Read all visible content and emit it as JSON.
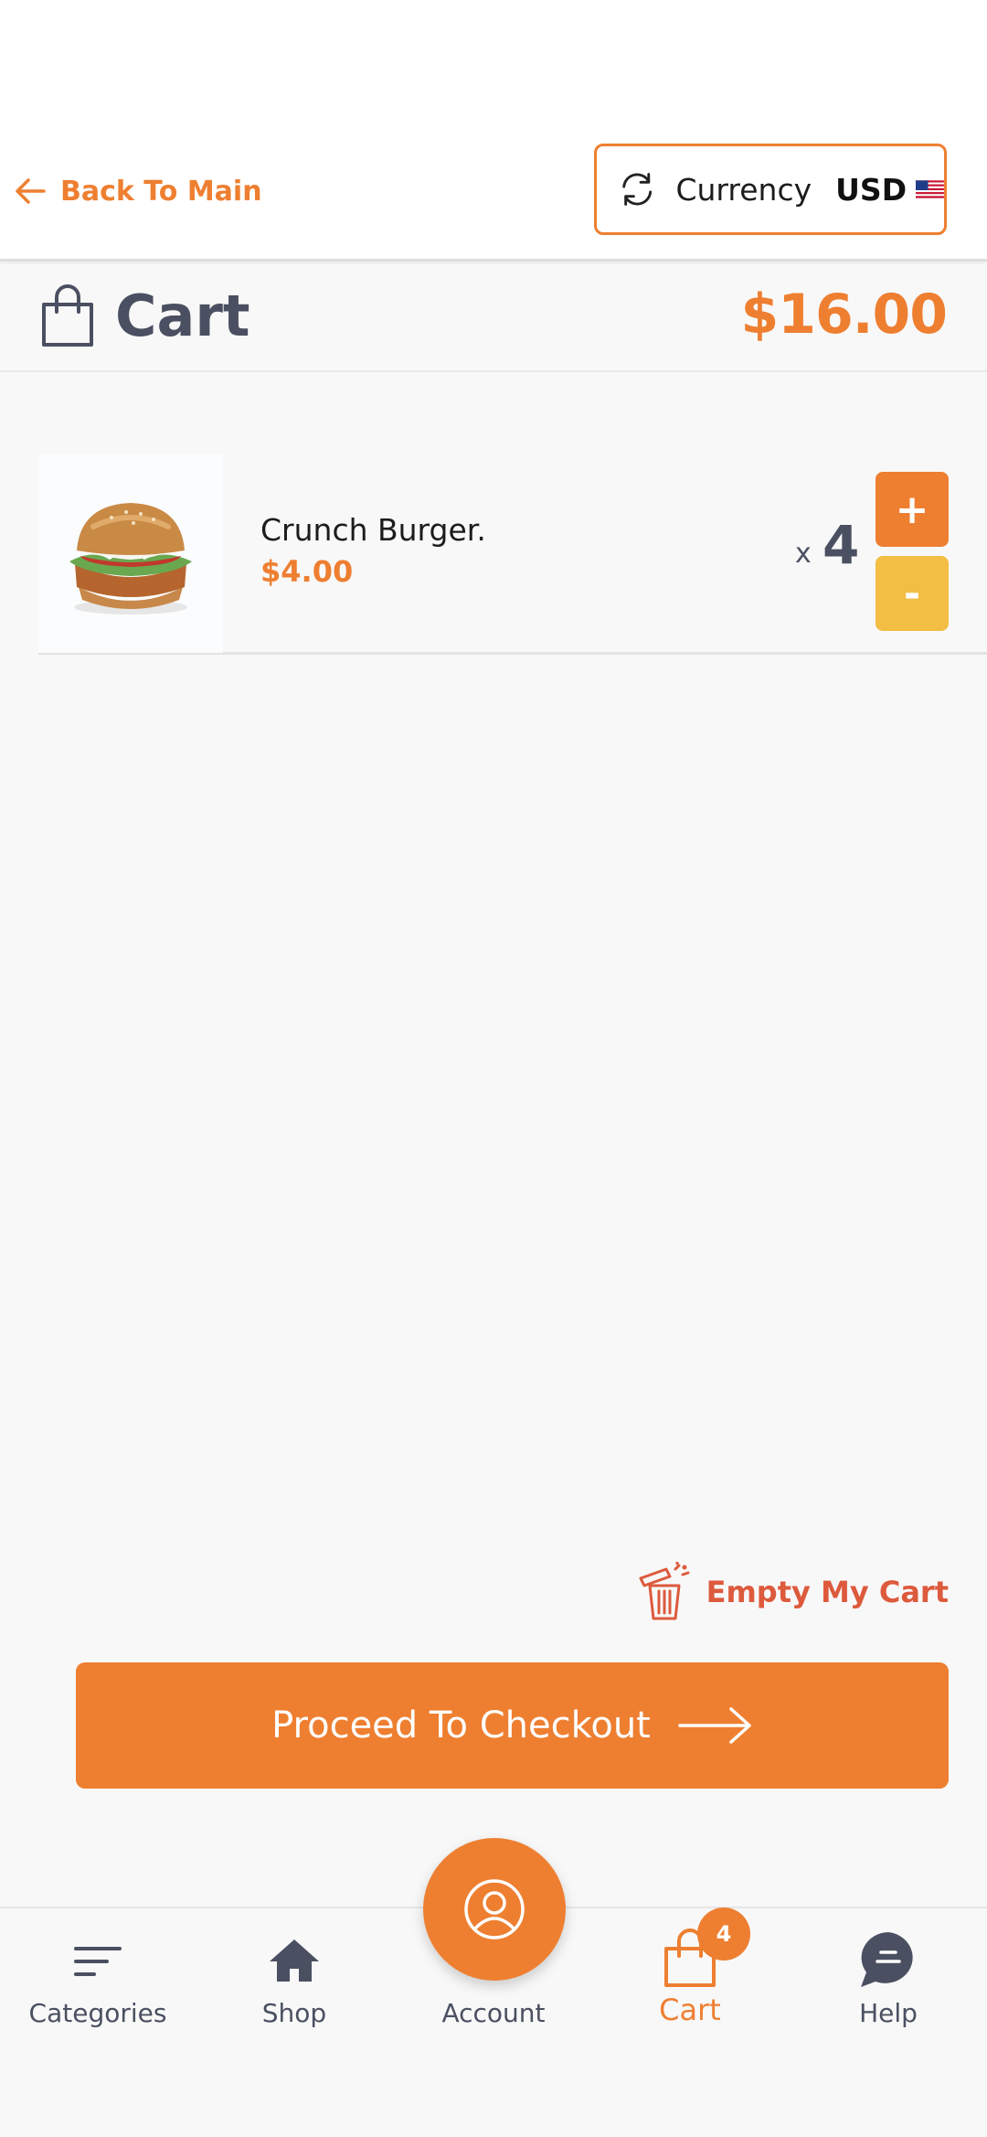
{
  "header": {
    "back_label": "Back To Main",
    "currency_label": "Currency",
    "currency_code": "USD"
  },
  "cart": {
    "title": "Cart",
    "total": "$16.00"
  },
  "items": [
    {
      "name": "Crunch Burger.",
      "price": "$4.00",
      "qty_prefix": "x",
      "quantity": "4",
      "plus_label": "+",
      "minus_label": "-"
    }
  ],
  "actions": {
    "empty_cart": "Empty My Cart",
    "checkout": "Proceed To Checkout"
  },
  "nav": {
    "categories": "Categories",
    "shop": "Shop",
    "account": "Account",
    "cart": "Cart",
    "cart_badge": "4",
    "help": "Help"
  },
  "colors": {
    "accent": "#ee7f31",
    "secondary": "#f2be43",
    "text_dark": "#4a5061",
    "danger": "#dd5a3d"
  }
}
